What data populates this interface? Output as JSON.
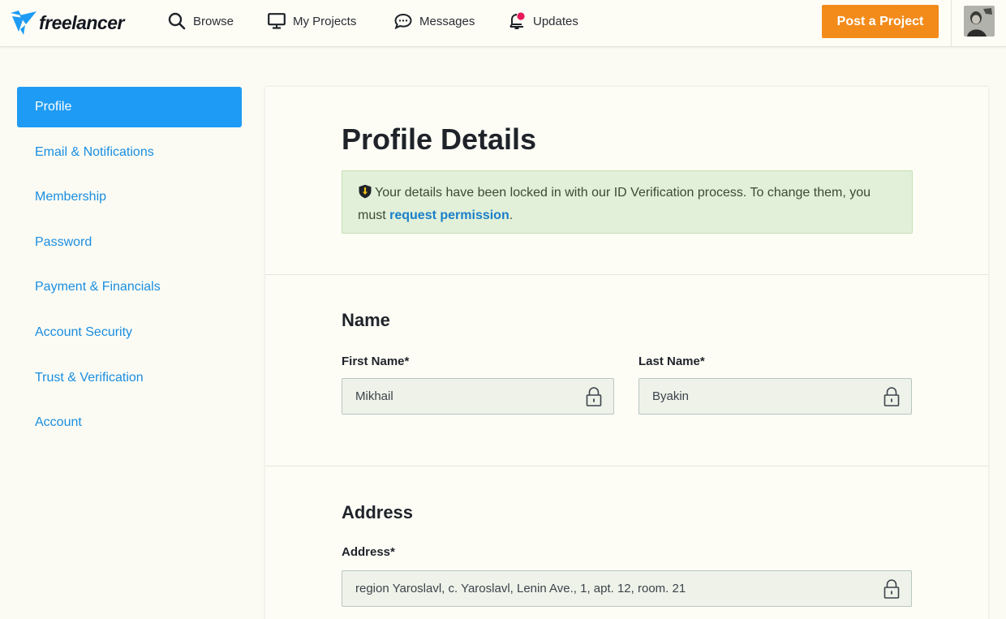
{
  "brand": {
    "name": "freelancer",
    "accent": "#1e9bf4",
    "cta": "#f38b1b"
  },
  "nav": {
    "browse": {
      "label": "Browse",
      "icon": "search-icon"
    },
    "projects": {
      "label": "My Projects",
      "icon": "monitor-icon"
    },
    "messages": {
      "label": "Messages",
      "icon": "chat-bubble-icon"
    },
    "updates": {
      "label": "Updates",
      "icon": "bell-icon",
      "has_notification": true
    },
    "post_project": "Post a Project"
  },
  "sidebar": {
    "items": [
      {
        "label": "Profile",
        "active": true
      },
      {
        "label": "Email & Notifications",
        "active": false
      },
      {
        "label": "Membership",
        "active": false
      },
      {
        "label": "Password",
        "active": false
      },
      {
        "label": "Payment & Financials",
        "active": false
      },
      {
        "label": "Account Security",
        "active": false
      },
      {
        "label": "Trust & Verification",
        "active": false
      },
      {
        "label": "Account",
        "active": false
      }
    ]
  },
  "main": {
    "title": "Profile Details",
    "notice": {
      "text_before": "Your details have been locked in with our ID Verification process. To change them, you must ",
      "link": "request permission",
      "text_after": "."
    },
    "name_section": {
      "title": "Name",
      "first_name": {
        "label": "First Name*",
        "value": "Mikhail"
      },
      "last_name": {
        "label": "Last Name*",
        "value": "Byakin"
      }
    },
    "address_section": {
      "title": "Address",
      "address": {
        "label": "Address*",
        "value": "region Yaroslavl, c. Yaroslavl, Lenin Ave., 1, apt. 12, room. 21"
      }
    }
  }
}
